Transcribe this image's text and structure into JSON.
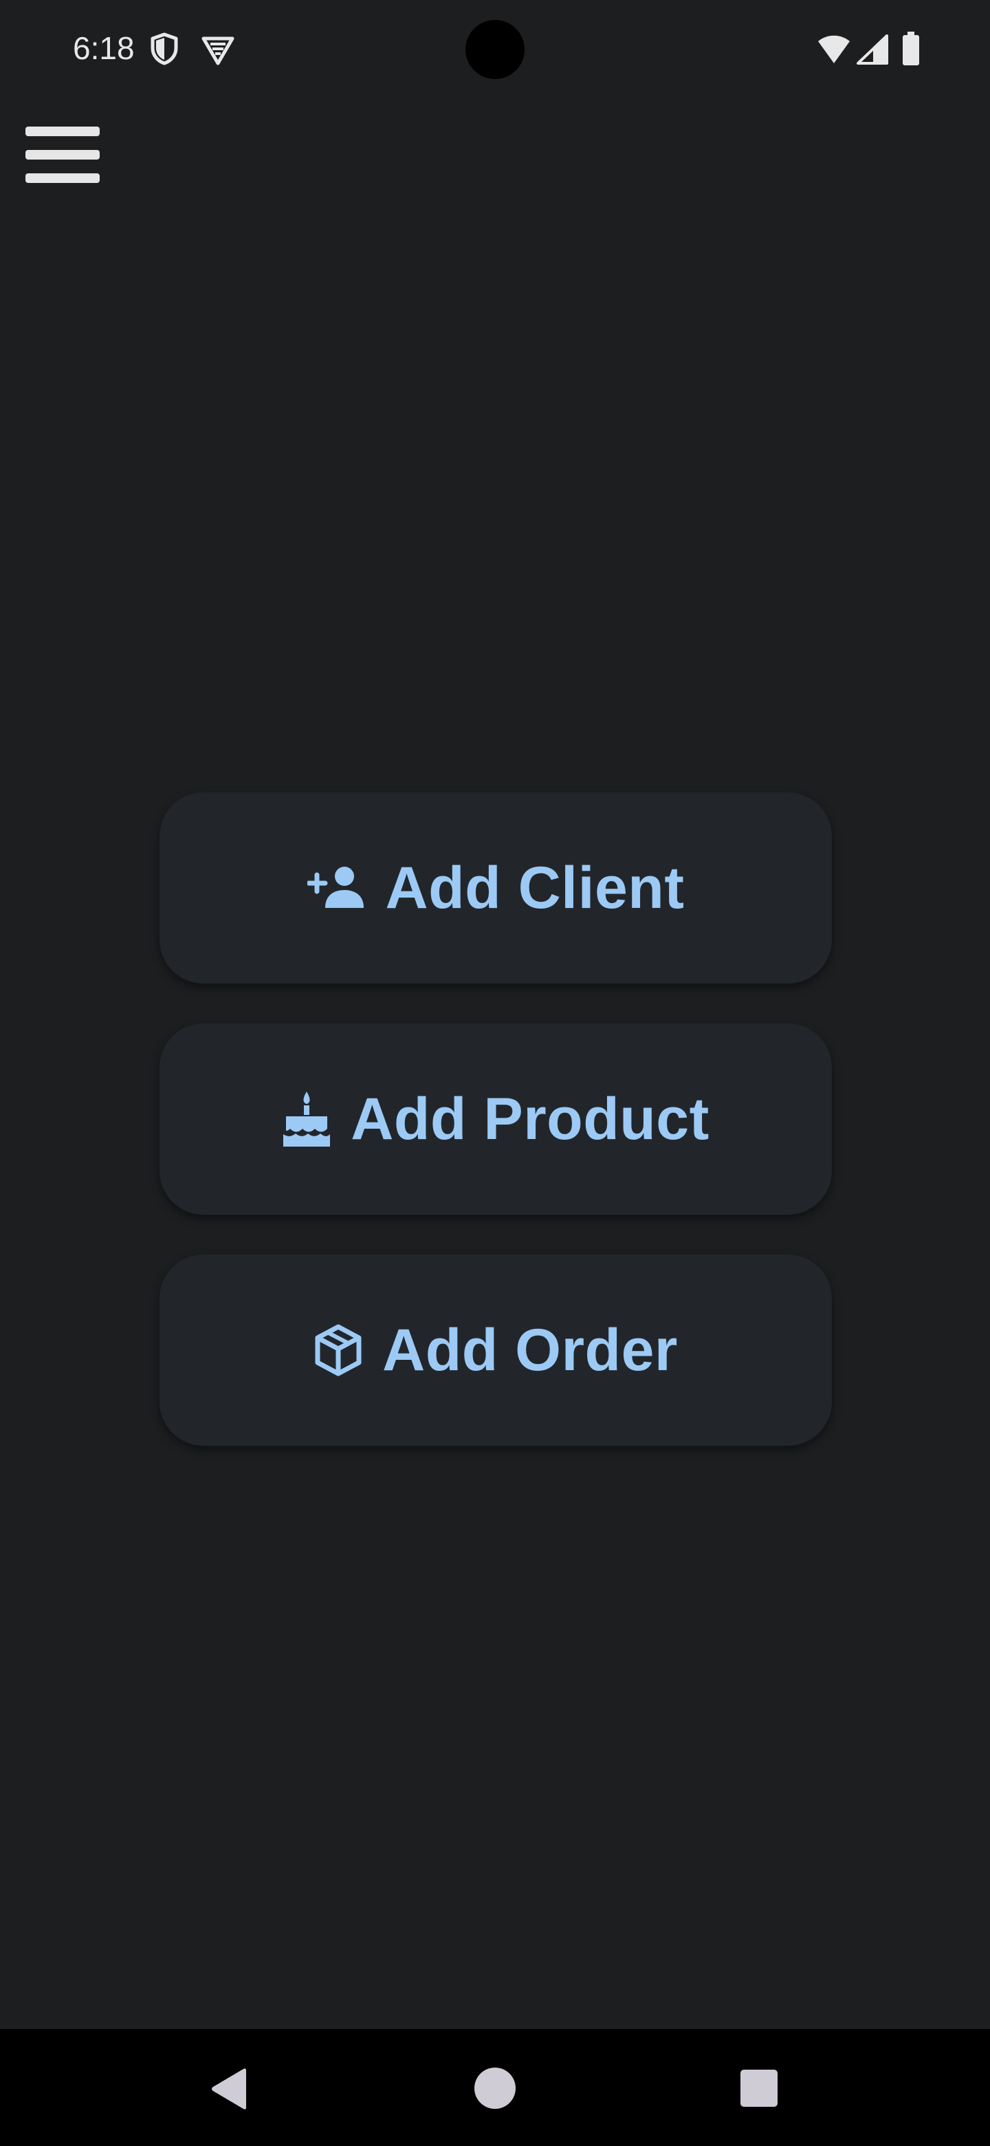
{
  "status_bar": {
    "time": "6:18",
    "icons": [
      "shield-icon",
      "vpn-triangle-icon",
      "wifi-icon",
      "cell-signal-icon",
      "battery-icon"
    ],
    "icon_color": "#e8e8e8"
  },
  "header": {
    "menu_icon": "hamburger-menu-icon"
  },
  "actions": {
    "add_client": {
      "label": "Add Client",
      "icon": "person-add-icon"
    },
    "add_product": {
      "label": "Add Product",
      "icon": "cake-icon"
    },
    "add_order": {
      "label": "Add Order",
      "icon": "package-icon"
    }
  },
  "nav_bar": {
    "back_icon": "back-triangle-icon",
    "home_icon": "home-circle-icon",
    "recents_icon": "recents-square-icon"
  },
  "colors": {
    "background": "#1d1e20",
    "button_background": "#22262b",
    "accent": "#9ccaf5",
    "nav_bar": "#000000",
    "nav_icons": "#cfccd6"
  }
}
